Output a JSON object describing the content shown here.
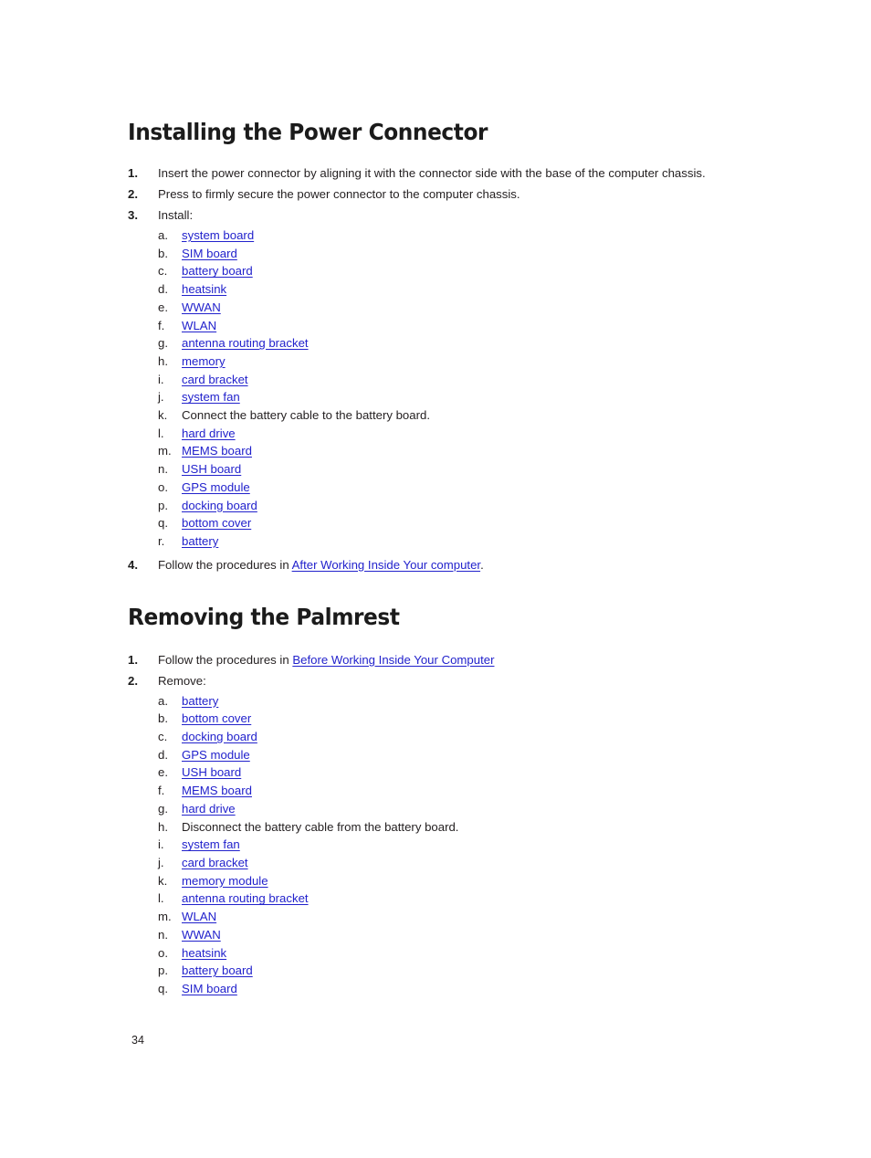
{
  "document": {
    "page_number": "34",
    "link_color": "#2222cc",
    "text_color": "#231f20"
  },
  "sections": [
    {
      "heading": "Installing the Power Connector",
      "steps": [
        {
          "marker": "1.",
          "text": "Insert the power connector by aligning it with the connector side with the base of the computer chassis."
        },
        {
          "marker": "2.",
          "text": "Press to firmly secure the power connector to the computer chassis."
        },
        {
          "marker": "3.",
          "text": "Install:",
          "substeps": [
            {
              "marker": "a.",
              "text": "system board",
              "link": true
            },
            {
              "marker": "b.",
              "text": "SIM board",
              "link": true
            },
            {
              "marker": "c.",
              "text": "battery board",
              "link": true
            },
            {
              "marker": "d.",
              "text": "heatsink",
              "link": true
            },
            {
              "marker": "e.",
              "text": "WWAN",
              "link": true
            },
            {
              "marker": "f.",
              "text": "WLAN",
              "link": true
            },
            {
              "marker": "g.",
              "text": "antenna routing bracket",
              "link": true
            },
            {
              "marker": "h.",
              "text": "memory",
              "link": true
            },
            {
              "marker": "i.",
              "text": "card bracket",
              "link": true
            },
            {
              "marker": "j.",
              "text": "system fan",
              "link": true
            },
            {
              "marker": "k.",
              "text": "Connect the battery cable to the battery board.",
              "link": false
            },
            {
              "marker": "l.",
              "text": "hard drive",
              "link": true
            },
            {
              "marker": "m.",
              "text": "MEMS board",
              "link": true
            },
            {
              "marker": "n.",
              "text": "USH board",
              "link": true
            },
            {
              "marker": "o.",
              "text": "GPS module",
              "link": true
            },
            {
              "marker": "p.",
              "text": "docking board",
              "link": true
            },
            {
              "marker": "q.",
              "text": "bottom cover",
              "link": true
            },
            {
              "marker": "r.",
              "text": "battery",
              "link": true
            }
          ]
        },
        {
          "marker": "4.",
          "prefix": "Follow the procedures in ",
          "link_text": "After Working Inside Your computer",
          "suffix": "."
        }
      ]
    },
    {
      "heading": "Removing the Palmrest",
      "steps": [
        {
          "marker": "1.",
          "prefix": "Follow the procedures in ",
          "link_text": "Before Working Inside Your Computer",
          "suffix": ""
        },
        {
          "marker": "2.",
          "text": "Remove:",
          "substeps": [
            {
              "marker": "a.",
              "text": "battery",
              "link": true
            },
            {
              "marker": "b.",
              "text": "bottom cover",
              "link": true
            },
            {
              "marker": "c.",
              "text": "docking board",
              "link": true
            },
            {
              "marker": "d.",
              "text": "GPS module",
              "link": true
            },
            {
              "marker": "e.",
              "text": "USH board",
              "link": true
            },
            {
              "marker": "f.",
              "text": "MEMS board",
              "link": true
            },
            {
              "marker": "g.",
              "text": "hard drive",
              "link": true
            },
            {
              "marker": "h.",
              "text": "Disconnect the battery cable from the battery board.",
              "link": false
            },
            {
              "marker": "i.",
              "text": "system fan",
              "link": true
            },
            {
              "marker": "j.",
              "text": "card bracket",
              "link": true
            },
            {
              "marker": "k.",
              "text": "memory module",
              "link": true
            },
            {
              "marker": "l.",
              "text": "antenna routing bracket",
              "link": true
            },
            {
              "marker": "m.",
              "text": "WLAN",
              "link": true
            },
            {
              "marker": "n.",
              "text": "WWAN",
              "link": true
            },
            {
              "marker": "o.",
              "text": "heatsink",
              "link": true
            },
            {
              "marker": "p.",
              "text": "battery board",
              "link": true
            },
            {
              "marker": "q.",
              "text": "SIM board",
              "link": true
            }
          ]
        }
      ]
    }
  ]
}
